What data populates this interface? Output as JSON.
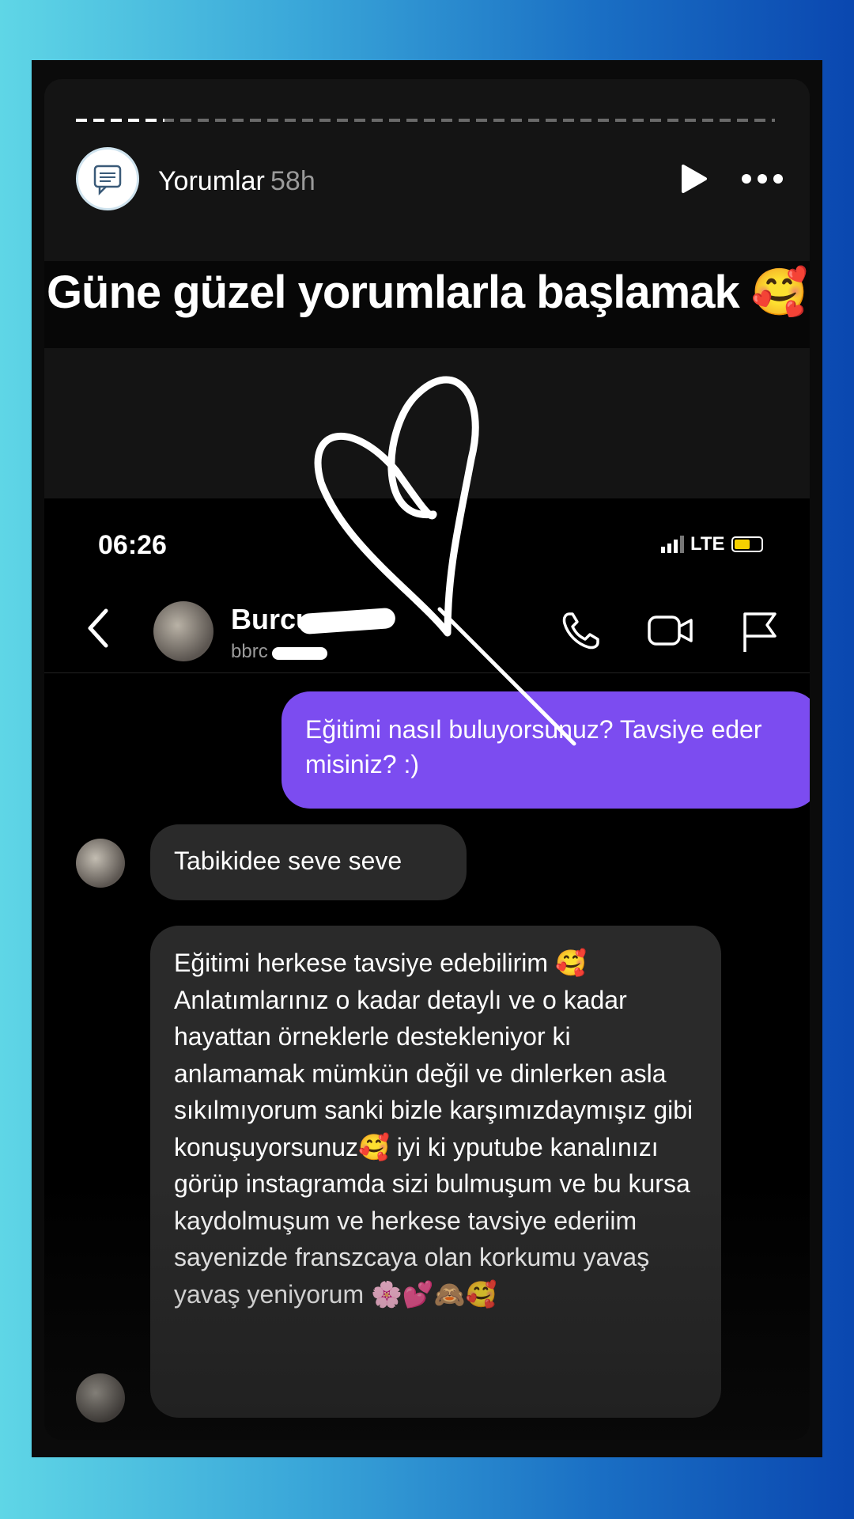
{
  "story": {
    "user_name": "Yorumlar",
    "time_ago": "58h",
    "caption": "Güne güzel yorumlarla başlamak 🥰",
    "icons": {
      "avatar": "speech-bubble-icon",
      "play": "play-icon",
      "more": "more-dots-icon"
    }
  },
  "screenshot": {
    "status": {
      "time": "06:26",
      "network": "LTE"
    },
    "contact": {
      "name": "Burcu",
      "handle": "bbrc"
    },
    "messages": {
      "sent": "Eğitimi nasıl buluyorsunuz? Tavsiye eder misiniz? :)",
      "reply_short": "Tabikidee seve seve",
      "reply_long": "Eğitimi herkese tavsiye edebilirim 🥰 Anlatımlarınız o kadar detaylı ve o kadar hayattan örneklerle destekleniyor ki anlamamak mümkün değil ve dinlerken asla sıkılmıyorum sanki bizle karşımızdaymışız gibi konuşuyorsunuz🥰 iyi ki yputube kanalınızı görüp instagramda sizi bulmuşum ve bu kursa kaydolmuşum ve herkese tavsiye ederiim sayenizde franszcaya olan korkumu yavaş yavaş yeniyorum 🌸💕🙈🥰"
    },
    "colors": {
      "sent_bubble": "#7c4cf0",
      "received_bubble": "#2a2a2a",
      "battery": "#f5d000"
    }
  }
}
